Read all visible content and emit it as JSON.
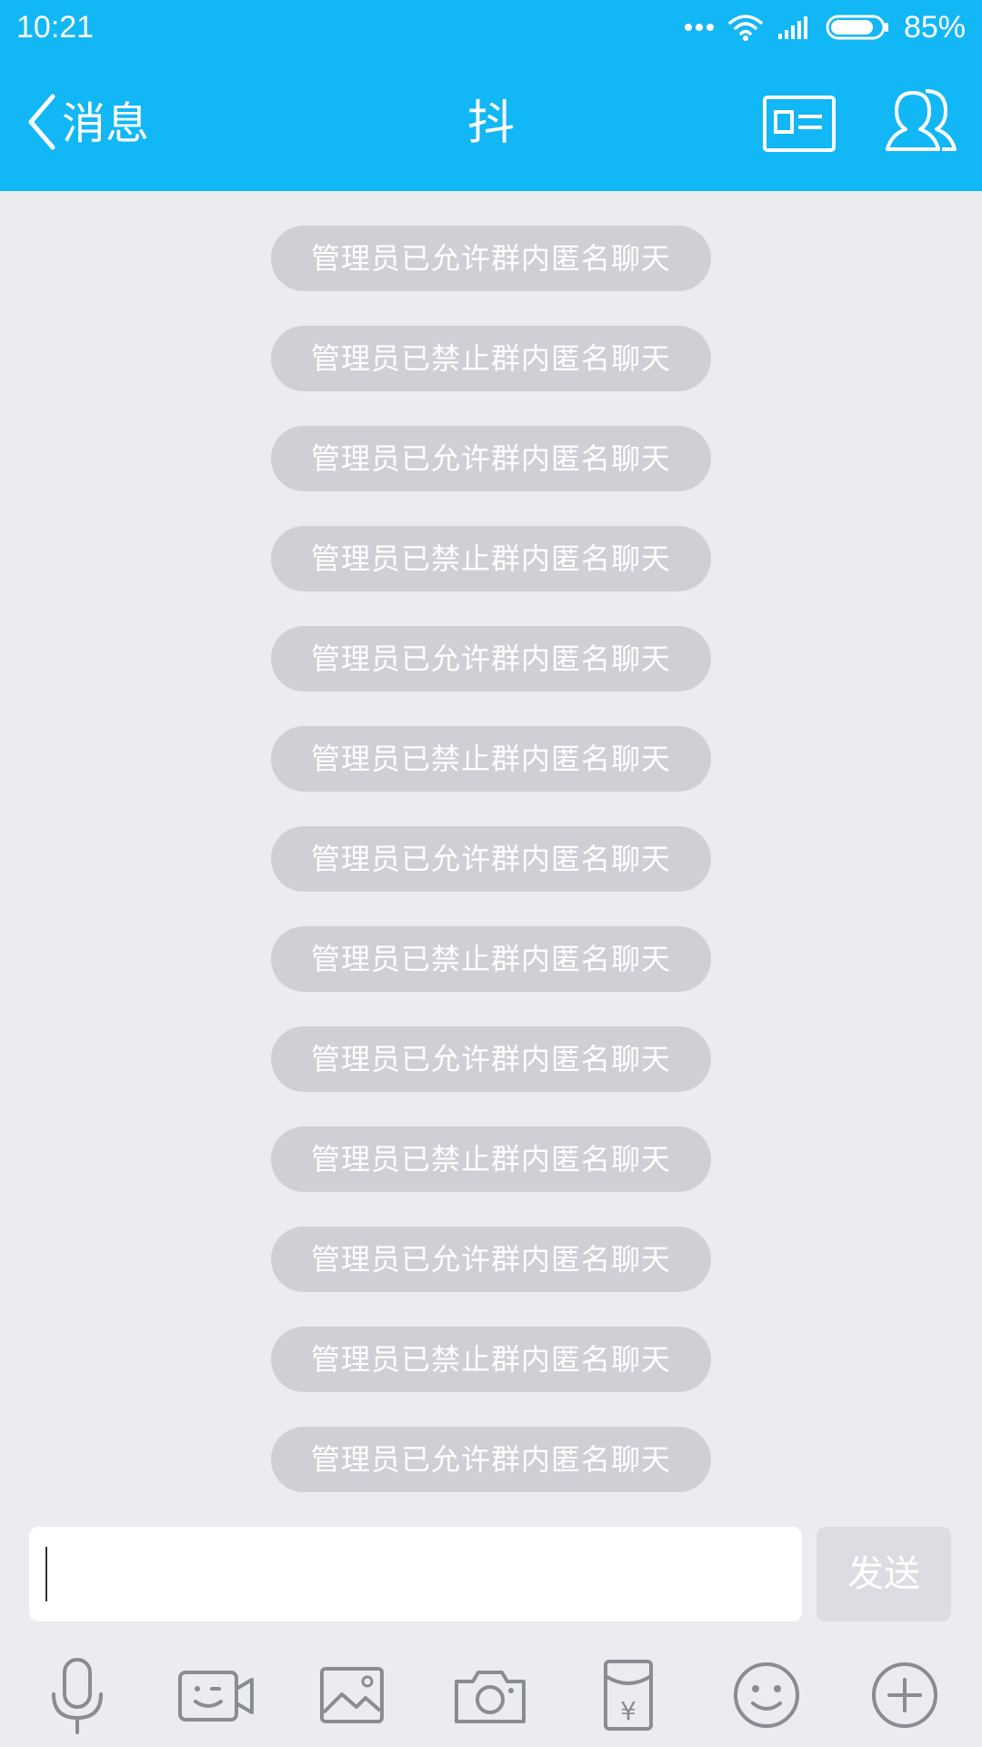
{
  "status_bar": {
    "time": "10:21",
    "battery_percent": "85%",
    "battery_level": 0.85,
    "icons": [
      "more-dots-icon",
      "wifi-icon",
      "signal-icon",
      "battery-icon"
    ]
  },
  "header": {
    "back_label": "消息",
    "title": "抖",
    "actions": [
      "contact-card-icon",
      "group-members-icon"
    ],
    "background_color": "#12b7f5"
  },
  "messages": [
    {
      "text": "管理员已允许群内匿名聊天"
    },
    {
      "text": "管理员已禁止群内匿名聊天"
    },
    {
      "text": "管理员已允许群内匿名聊天"
    },
    {
      "text": "管理员已禁止群内匿名聊天"
    },
    {
      "text": "管理员已允许群内匿名聊天"
    },
    {
      "text": "管理员已禁止群内匿名聊天"
    },
    {
      "text": "管理员已允许群内匿名聊天"
    },
    {
      "text": "管理员已禁止群内匿名聊天"
    },
    {
      "text": "管理员已允许群内匿名聊天"
    },
    {
      "text": "管理员已禁止群内匿名聊天"
    },
    {
      "text": "管理员已允许群内匿名聊天"
    },
    {
      "text": "管理员已禁止群内匿名聊天"
    },
    {
      "text": "管理员已允许群内匿名聊天"
    }
  ],
  "composer": {
    "input_value": "",
    "send_label": "发送"
  },
  "toolbar": {
    "items": [
      "microphone-icon",
      "video-call-icon",
      "image-icon",
      "camera-icon",
      "red-packet-icon",
      "emoji-icon",
      "plus-icon"
    ],
    "icon_color": "#8a8c93"
  }
}
